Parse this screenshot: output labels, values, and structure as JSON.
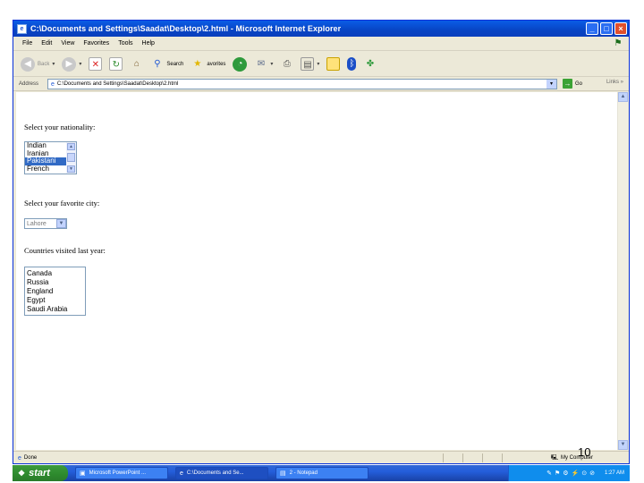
{
  "window": {
    "title": "C:\\Documents and Settings\\Saadat\\Desktop\\2.html - Microsoft Internet Explorer",
    "buttons": {
      "minimize": "_",
      "maximize": "□",
      "close": "×"
    }
  },
  "menu": [
    "File",
    "Edit",
    "View",
    "Favorites",
    "Tools",
    "Help"
  ],
  "toolbar": {
    "back": "Back",
    "search": "Search",
    "favorites": "avorites"
  },
  "address": {
    "label": "Address",
    "value": "C:\\Documents and Settings\\Saadat\\Desktop\\2.html",
    "go": "Go",
    "links": "Links"
  },
  "form": {
    "nationality_label": "Select your nationality:",
    "nationality_options": [
      "Indian",
      "Iranian",
      "Pakistani",
      "French"
    ],
    "nationality_selected": "Pakistani",
    "city_label": "Select your favorite city:",
    "city_value": "Lahore",
    "countries_label": "Countries visited last year:",
    "countries_options": [
      "Canada",
      "Russia",
      "England",
      "Egypt",
      "Saudi Arabia"
    ]
  },
  "status": {
    "text": "Done",
    "zone": "My Computer"
  },
  "slide_number": "10",
  "taskbar": {
    "start": "start",
    "tasks": [
      "Microsoft PowerPoint ...",
      "C:\\Documents and Se...",
      "2 - Notepad"
    ],
    "clock": "1:27 AM"
  },
  "colors": {
    "titlebar": "#0a5de6",
    "selection": "#316ac5",
    "taskbar": "#245edb",
    "start": "#3c9b3c"
  }
}
